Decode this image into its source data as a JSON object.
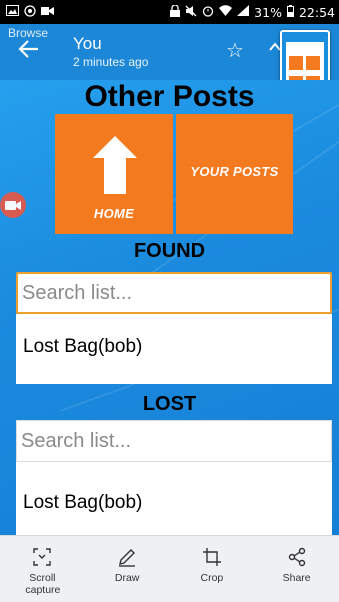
{
  "status_bar": {
    "battery": "31%",
    "time": "22:54"
  },
  "app_bar": {
    "overlay_label": "Browse",
    "title": "You",
    "subtitle": "2 minutes ago"
  },
  "page": {
    "heading": "Other Posts",
    "tiles": {
      "home_label": "HOME",
      "posts_label": "YOUR POSTS"
    },
    "found": {
      "label": "FOUND",
      "search_placeholder": "Search list...",
      "items": [
        "Lost Bag(bob)"
      ]
    },
    "lost": {
      "label": "LOST",
      "search_placeholder": "Search list...",
      "items": [
        "Lost Bag(bob)"
      ]
    }
  },
  "toolbar": {
    "scroll_capture": "Scroll capture",
    "draw": "Draw",
    "crop": "Crop",
    "share": "Share"
  },
  "colors": {
    "accent_orange": "#f47a20",
    "background_blue": "#1a8fdf"
  }
}
